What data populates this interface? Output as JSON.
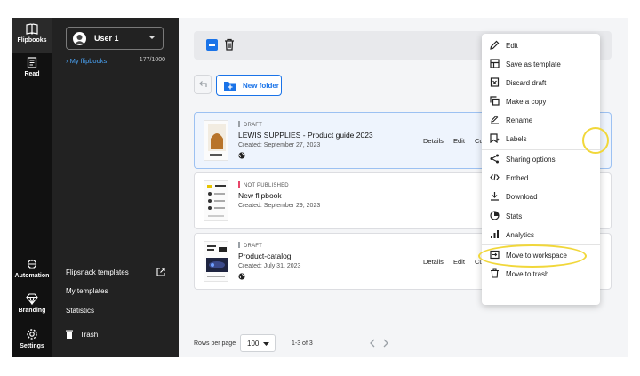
{
  "rail": {
    "items": [
      {
        "label": "Flipbooks",
        "icon": "book-icon"
      },
      {
        "label": "Read",
        "icon": "reader-icon"
      },
      {
        "label": "Automation",
        "icon": "automation-icon"
      },
      {
        "label": "Branding",
        "icon": "diamond-icon"
      },
      {
        "label": "Settings",
        "icon": "gear-icon"
      }
    ]
  },
  "sidebar": {
    "user": "User 1",
    "my_flipbooks": "My flipbooks",
    "count": "177/1000",
    "links": {
      "templates": "Flipsnack templates",
      "my_templates": "My templates",
      "statistics": "Statistics",
      "trash": "Trash"
    }
  },
  "toolbar": {
    "new_folder": "New folder"
  },
  "flipbooks": [
    {
      "status": "DRAFT",
      "status_color": "#9aa0a6",
      "title": "LEWIS SUPPLIES - Product guide 2023",
      "created": "Created: September 27, 2023",
      "actions": [
        "Details",
        "Edit",
        "Cu"
      ]
    },
    {
      "status": "NOT PUBLISHED",
      "status_color": "#e8476a",
      "title": "New flipbook",
      "created": "Created: September 29, 2023",
      "actions": []
    },
    {
      "status": "DRAFT",
      "status_color": "#9aa0a6",
      "title": "Product-catalog",
      "created": "Created: July 31, 2023",
      "actions": [
        "Details",
        "Edit",
        "Cu"
      ]
    }
  ],
  "menu": {
    "items": [
      {
        "label": "Edit",
        "icon": "pencil-icon"
      },
      {
        "label": "Save as template",
        "icon": "template-icon"
      },
      {
        "label": "Discard draft",
        "icon": "discard-icon"
      },
      {
        "label": "Make a copy",
        "icon": "copy-icon"
      },
      {
        "label": "Rename",
        "icon": "rename-icon"
      },
      {
        "label": "Labels",
        "icon": "label-icon"
      },
      {
        "label": "Sharing options",
        "icon": "share-icon"
      },
      {
        "label": "Embed",
        "icon": "code-icon"
      },
      {
        "label": "Download",
        "icon": "download-icon"
      },
      {
        "label": "Stats",
        "icon": "pie-icon"
      },
      {
        "label": "Analytics",
        "icon": "bars-icon"
      },
      {
        "label": "Move to workspace",
        "icon": "move-icon"
      },
      {
        "label": "Move to trash",
        "icon": "trash-icon"
      }
    ]
  },
  "pagination": {
    "rows_label": "Rows per page",
    "rows_value": "100",
    "range": "1-3 of 3"
  },
  "colors": {
    "accent": "#1a73e8",
    "sidebar_bg": "#222222",
    "rail_bg": "#111111",
    "highlight": "#f1d73a"
  }
}
